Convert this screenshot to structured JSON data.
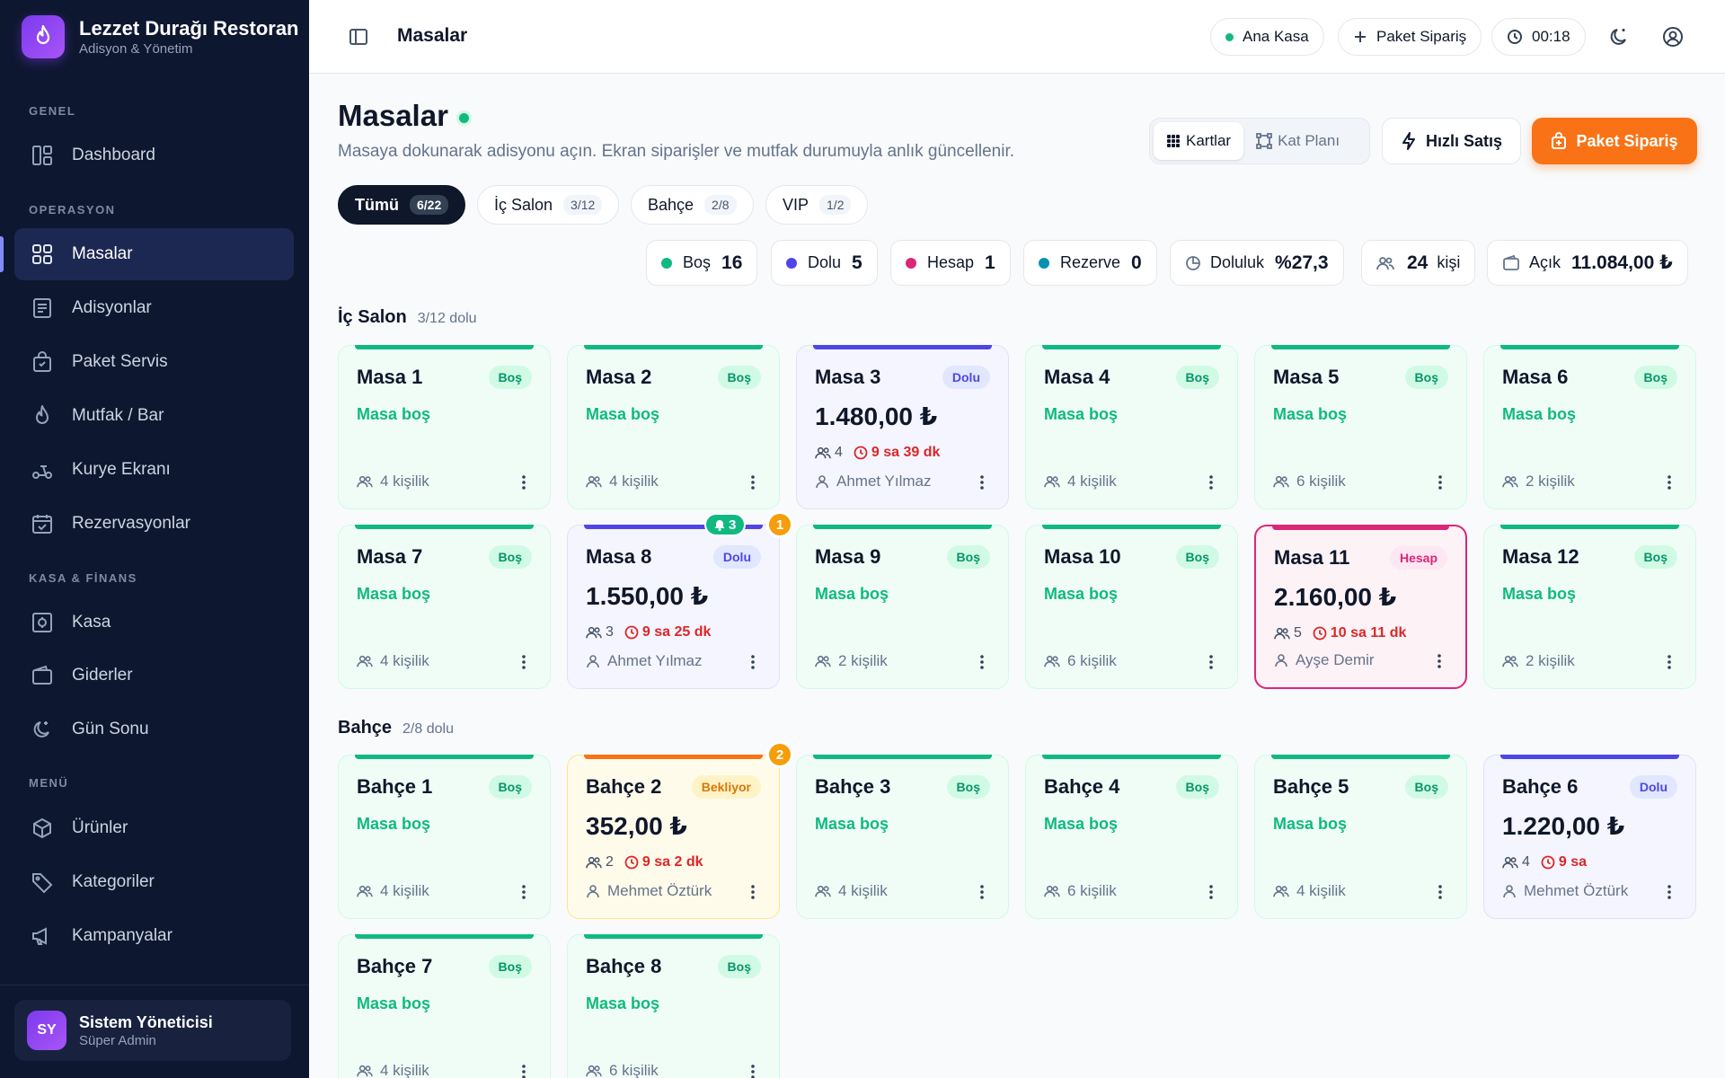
{
  "brand": {
    "name": "Lezzet Durağı Restoran",
    "sub": "Adisyon & Yönetim"
  },
  "sidebar": {
    "sections": {
      "genel": "GENEL",
      "operasyon": "OPERASYON",
      "kasa": "KASA & FİNANS",
      "menu": "MENÜ"
    },
    "items": {
      "dashboard": "Dashboard",
      "masalar": "Masalar",
      "adisyonlar": "Adisyonlar",
      "paket": "Paket Servis",
      "mutfak": "Mutfak / Bar",
      "kurye": "Kurye Ekranı",
      "rezervasyon": "Rezervasyonlar",
      "kasa": "Kasa",
      "giderler": "Giderler",
      "gunsonu": "Gün Sonu",
      "urunler": "Ürünler",
      "kategoriler": "Kategoriler",
      "kampanyalar": "Kampanyalar"
    }
  },
  "user": {
    "initials": "SY",
    "name": "Sistem Yöneticisi",
    "role": "Süper Admin"
  },
  "topbar": {
    "title": "Masalar",
    "register": "Ana Kasa",
    "package": "Paket Sipariş",
    "timer": "00:18"
  },
  "page": {
    "title": "Masalar",
    "subtitle": "Masaya dokunarak adisyonu açın. Ekran siparişler ve mutfak durumuyla anlık güncellenir.",
    "view_cards": "Kartlar",
    "view_floor": "Kat Planı",
    "quick_sale": "Hızlı Satış",
    "package_order": "Paket Sipariş"
  },
  "tabs": [
    {
      "label": "Tümü",
      "count": "6/22"
    },
    {
      "label": "İç Salon",
      "count": "3/12"
    },
    {
      "label": "Bahçe",
      "count": "2/8"
    },
    {
      "label": "VIP",
      "count": "1/2"
    }
  ],
  "stats": {
    "bos": {
      "label": "Boş",
      "value": "16"
    },
    "dolu": {
      "label": "Dolu",
      "value": "5"
    },
    "hesap": {
      "label": "Hesap",
      "value": "1"
    },
    "rezerve": {
      "label": "Rezerve",
      "value": "0"
    },
    "doluluk": {
      "label": "Doluluk",
      "value": "%27,3"
    },
    "kisi": {
      "value": "24",
      "suffix": "kişi"
    },
    "acik": {
      "label": "Açık",
      "value": "11.084,00 ₺"
    }
  },
  "colors": {
    "bos": "#10b981",
    "dolu": "#4f46e5",
    "hesap": "#db2777",
    "rezerve": "#0891b2",
    "accent": "#f97316"
  },
  "sections": [
    {
      "title": "İç Salon",
      "count": "3/12 dolu",
      "tables": [
        {
          "name": "Masa 1",
          "status": "Boş",
          "state": "bos",
          "empty": "Masa boş",
          "cap": "4 kişilik"
        },
        {
          "name": "Masa 2",
          "status": "Boş",
          "state": "bos",
          "empty": "Masa boş",
          "cap": "4 kişilik"
        },
        {
          "name": "Masa 3",
          "status": "Dolu",
          "state": "dolu",
          "amount": "1.480,00 ₺",
          "guests": "4",
          "time": "9 sa 39 dk",
          "waiter": "Ahmet Yılmaz"
        },
        {
          "name": "Masa 4",
          "status": "Boş",
          "state": "bos",
          "empty": "Masa boş",
          "cap": "4 kişilik"
        },
        {
          "name": "Masa 5",
          "status": "Boş",
          "state": "bos",
          "empty": "Masa boş",
          "cap": "6 kişilik"
        },
        {
          "name": "Masa 6",
          "status": "Boş",
          "state": "bos",
          "empty": "Masa boş",
          "cap": "2 kişilik"
        },
        {
          "name": "Masa 7",
          "status": "Boş",
          "state": "bos",
          "empty": "Masa boş",
          "cap": "4 kişilik"
        },
        {
          "name": "Masa 8",
          "status": "Dolu",
          "state": "dolu",
          "amount": "1.550,00 ₺",
          "guests": "3",
          "time": "9 sa 25 dk",
          "waiter": "Ahmet Yılmaz",
          "bell": "3",
          "notif": "1"
        },
        {
          "name": "Masa 9",
          "status": "Boş",
          "state": "bos",
          "empty": "Masa boş",
          "cap": "2 kişilik"
        },
        {
          "name": "Masa 10",
          "status": "Boş",
          "state": "bos",
          "empty": "Masa boş",
          "cap": "6 kişilik"
        },
        {
          "name": "Masa 11",
          "status": "Hesap",
          "state": "hesap",
          "amount": "2.160,00 ₺",
          "guests": "5",
          "time": "10 sa 11 dk",
          "waiter": "Ayşe Demir"
        },
        {
          "name": "Masa 12",
          "status": "Boş",
          "state": "bos",
          "empty": "Masa boş",
          "cap": "2 kişilik"
        }
      ]
    },
    {
      "title": "Bahçe",
      "count": "2/8 dolu",
      "tables": [
        {
          "name": "Bahçe 1",
          "status": "Boş",
          "state": "bos",
          "empty": "Masa boş",
          "cap": "4 kişilik"
        },
        {
          "name": "Bahçe 2",
          "status": "Bekliyor",
          "state": "bekliyor",
          "amount": "352,00 ₺",
          "guests": "2",
          "time": "9 sa 2 dk",
          "waiter": "Mehmet Öztürk",
          "notif": "2"
        },
        {
          "name": "Bahçe 3",
          "status": "Boş",
          "state": "bos",
          "empty": "Masa boş",
          "cap": "4 kişilik"
        },
        {
          "name": "Bahçe 4",
          "status": "Boş",
          "state": "bos",
          "empty": "Masa boş",
          "cap": "6 kişilik"
        },
        {
          "name": "Bahçe 5",
          "status": "Boş",
          "state": "bos",
          "empty": "Masa boş",
          "cap": "4 kişilik"
        },
        {
          "name": "Bahçe 6",
          "status": "Dolu",
          "state": "dolu",
          "amount": "1.220,00 ₺",
          "guests": "4",
          "time": "9 sa",
          "waiter": "Mehmet Öztürk"
        },
        {
          "name": "Bahçe 7",
          "status": "Boş",
          "state": "bos",
          "empty": "Masa boş",
          "cap": "4 kişilik"
        },
        {
          "name": "Bahçe 8",
          "status": "Boş",
          "state": "bos",
          "empty": "Masa boş",
          "cap": "6 kişilik"
        }
      ]
    }
  ]
}
